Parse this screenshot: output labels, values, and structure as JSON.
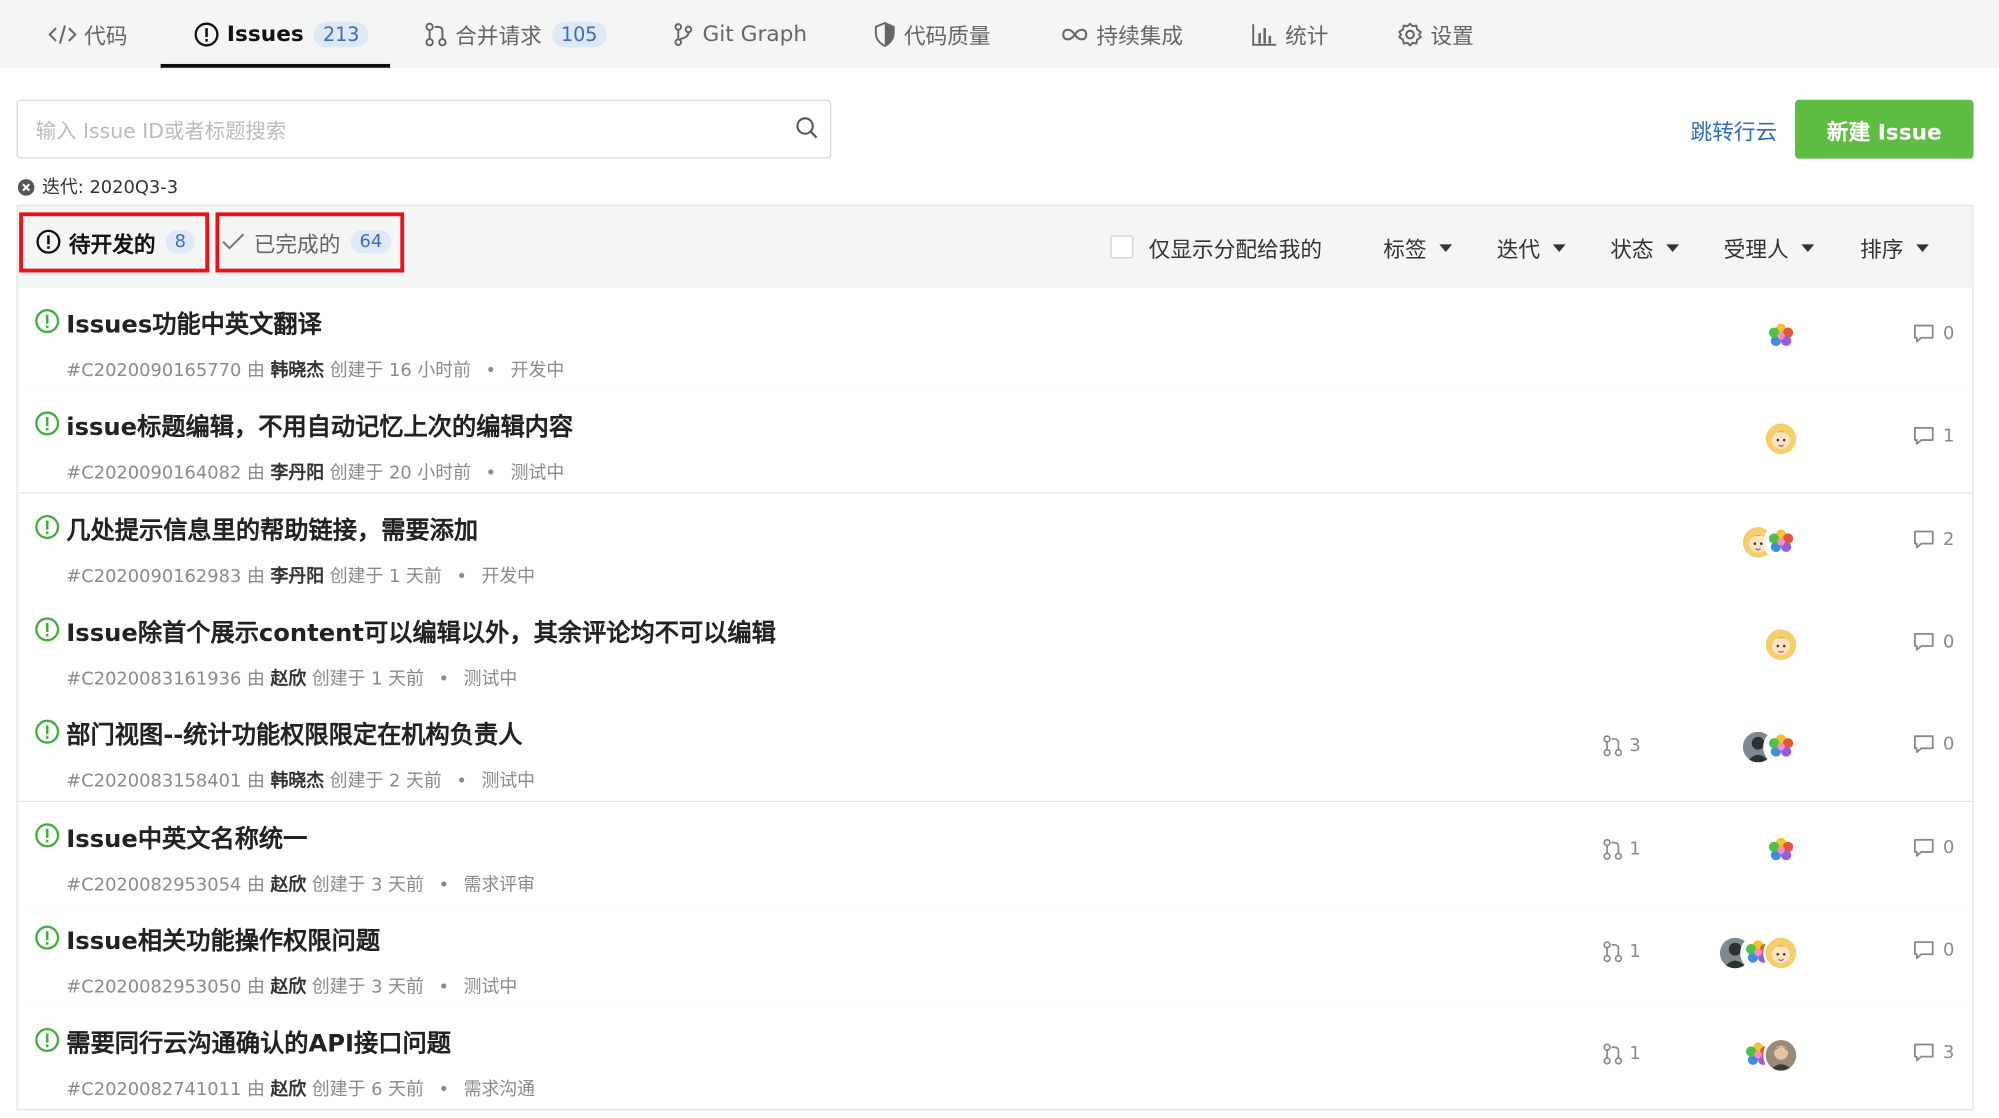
{
  "tabs": [
    {
      "label": "代码",
      "icon": "code-icon"
    },
    {
      "label": "Issues",
      "count": "213",
      "icon": "issue-icon",
      "active": true
    },
    {
      "label": "合并请求",
      "count": "105",
      "icon": "merge-request-icon"
    },
    {
      "label": "Git Graph",
      "icon": "git-graph-icon"
    },
    {
      "label": "代码质量",
      "icon": "shield-icon"
    },
    {
      "label": "持续集成",
      "icon": "infinity-icon"
    },
    {
      "label": "统计",
      "icon": "bar-chart-icon"
    },
    {
      "label": "设置",
      "icon": "gear-icon"
    }
  ],
  "search": {
    "placeholder": "输入 Issue ID或者标题搜索",
    "value": ""
  },
  "header_actions": {
    "jump_label": "跳转行云",
    "new_label": "新建 Issue"
  },
  "iteration_filter": {
    "label": "迭代: 2020Q3-3"
  },
  "filter_tabs": [
    {
      "label": "待开发的",
      "count": "8",
      "icon": "issue-icon"
    },
    {
      "label": "已完成的",
      "count": "64",
      "icon": "check-icon"
    }
  ],
  "filters": {
    "only_mine_label": "仅显示分配给我的",
    "only_mine_checked": false,
    "dropdowns": [
      "标签",
      "迭代",
      "状态",
      "受理人",
      "排序"
    ]
  },
  "issues": [
    {
      "title": "Issues功能中英文翻译",
      "id": "#C2020090165770",
      "by": "由",
      "author": "韩晓杰",
      "created": "创建于 16 小时前",
      "status": "开发中",
      "mr_count": "",
      "comments": "0",
      "assignees": [
        "flower-avatar"
      ]
    },
    {
      "title": "issue标题编辑，不用自动记忆上次的编辑内容",
      "id": "#C2020090164082",
      "by": "由",
      "author": "李丹阳",
      "created": "创建于 20 小时前",
      "status": "测试中",
      "mr_count": "",
      "comments": "1",
      "assignees": [
        "girl-avatar"
      ]
    },
    {
      "title": "几处提示信息里的帮助链接，需要添加",
      "id": "#C2020090162983",
      "by": "由",
      "author": "李丹阳",
      "created": "创建于 1 天前",
      "status": "开发中",
      "mr_count": "",
      "comments": "2",
      "assignees": [
        "girl-avatar",
        "flower-avatar"
      ]
    },
    {
      "title": "Issue除首个展示content可以编辑以外，其余评论均不可以编辑",
      "id": "#C2020083161936",
      "by": "由",
      "author": "赵欣",
      "created": "创建于 1 天前",
      "status": "测试中",
      "mr_count": "",
      "comments": "0",
      "assignees": [
        "girl-avatar"
      ]
    },
    {
      "title": "部门视图--统计功能权限限定在机构负责人",
      "id": "#C2020083158401",
      "by": "由",
      "author": "韩晓杰",
      "created": "创建于 2 天前",
      "status": "测试中",
      "mr_count": "3",
      "comments": "0",
      "assignees": [
        "dark-avatar",
        "flower-avatar"
      ]
    },
    {
      "title": "Issue中英文名称统一",
      "id": "#C2020082953054",
      "by": "由",
      "author": "赵欣",
      "created": "创建于 3 天前",
      "status": "需求评审",
      "mr_count": "1",
      "comments": "0",
      "assignees": [
        "flower-avatar"
      ]
    },
    {
      "title": "Issue相关功能操作权限问题",
      "id": "#C2020082953050",
      "by": "由",
      "author": "赵欣",
      "created": "创建于 3 天前",
      "status": "测试中",
      "mr_count": "1",
      "comments": "0",
      "assignees": [
        "dark-avatar",
        "flower-avatar",
        "girl-avatar"
      ]
    },
    {
      "title": "需要同行云沟通确认的API接口问题",
      "id": "#C2020082741011",
      "by": "由",
      "author": "赵欣",
      "created": "创建于 6 天前",
      "status": "需求沟通",
      "mr_count": "1",
      "comments": "3",
      "assignees": [
        "flower-avatar",
        "man-avatar"
      ]
    }
  ],
  "colors": {
    "accent": "#5fbd43",
    "link": "#2e6db7",
    "issue_open": "#3fae3a",
    "highlight": "#e8131b"
  }
}
